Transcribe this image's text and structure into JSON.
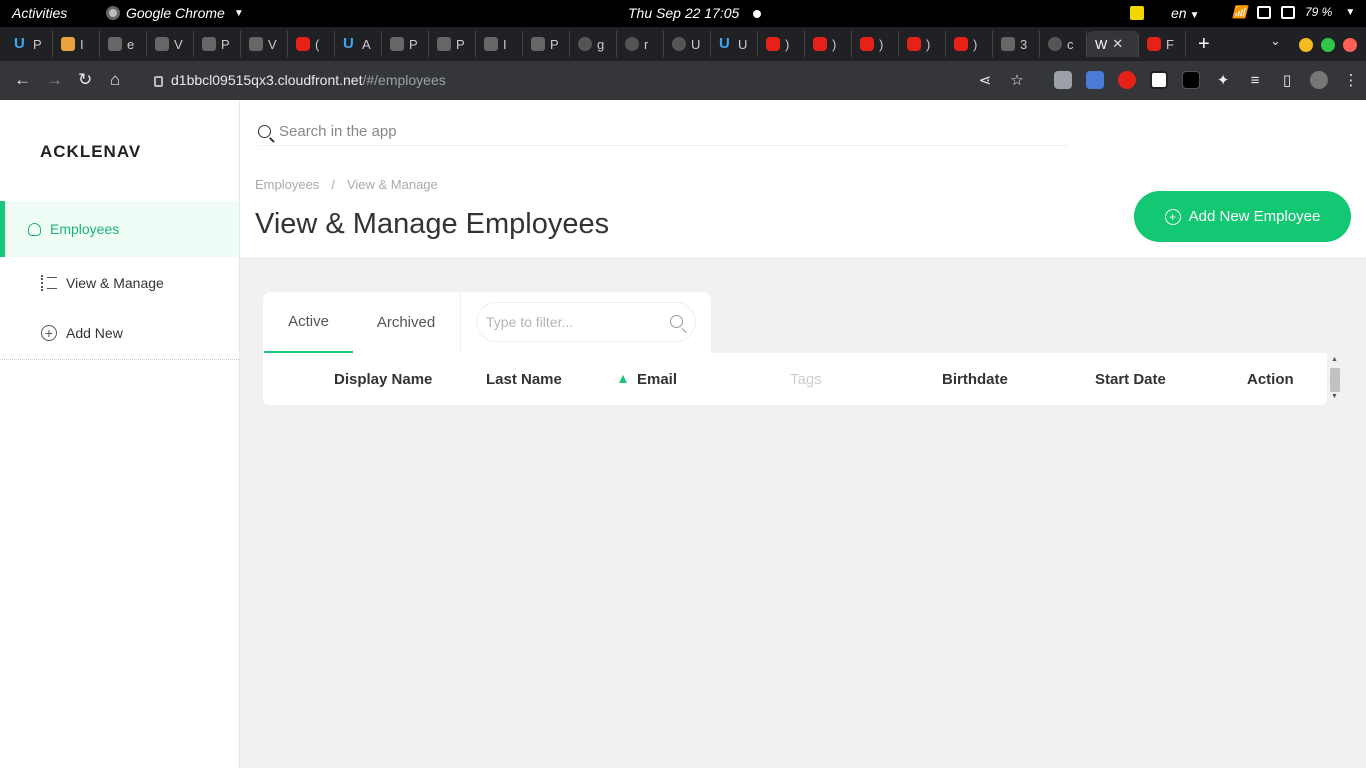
{
  "system": {
    "activities": "Activities",
    "app_name": "Google Chrome",
    "clock": "Thu Sep 22  17:05",
    "language": "en",
    "battery": "79 %"
  },
  "browser": {
    "tabs": [
      {
        "letter": "P",
        "icon": "upwork-icon"
      },
      {
        "letter": "I",
        "icon": "box-icon"
      },
      {
        "letter": "e",
        "icon": "globe-icon"
      },
      {
        "letter": "V",
        "icon": "globe-icon"
      },
      {
        "letter": "P",
        "icon": "page-icon"
      },
      {
        "letter": "V",
        "icon": "globe-icon"
      },
      {
        "letter": "(",
        "icon": "youtube-icon"
      },
      {
        "letter": "A",
        "icon": "upwork-icon"
      },
      {
        "letter": "P",
        "icon": "page-icon"
      },
      {
        "letter": "P",
        "icon": "page-icon"
      },
      {
        "letter": "I",
        "icon": "page-icon"
      },
      {
        "letter": "P",
        "icon": "target-icon"
      },
      {
        "letter": "g",
        "icon": "github-icon"
      },
      {
        "letter": "r",
        "icon": "github-icon"
      },
      {
        "letter": "U",
        "icon": "github-icon"
      },
      {
        "letter": "U",
        "icon": "upwork-icon"
      },
      {
        "letter": ")",
        "icon": "youtube-icon"
      },
      {
        "letter": ")",
        "icon": "youtube-icon"
      },
      {
        "letter": ")",
        "icon": "youtube-icon"
      },
      {
        "letter": ")",
        "icon": "youtube-icon"
      },
      {
        "letter": ")",
        "icon": "youtube-icon"
      },
      {
        "letter": "3",
        "icon": "globe-icon"
      },
      {
        "letter": "c",
        "icon": "github-icon"
      }
    ],
    "active_tab": {
      "letter": "W"
    },
    "next_tab": {
      "letter": "F"
    },
    "url_host": "d1bbcl09515qx3.cloudfront.net",
    "url_path": "/#/employees",
    "colors": {
      "close": "#f5b922",
      "minimize": "#f5b922",
      "maximize": "#30c648",
      "close_red": "#ff5f57"
    }
  },
  "app": {
    "logo": "ACKLENAVENUE",
    "search_placeholder": "Search in the app",
    "nav": {
      "employees": "Employees",
      "view_manage": "View & Manage",
      "add_new": "Add New"
    },
    "breadcrumb": [
      "Employees",
      "/",
      "View & Manage"
    ],
    "page_title": "View & Manage Employees",
    "add_button": "Add New Employee",
    "tabs": {
      "active": "Active",
      "archived": "Archived"
    },
    "filter_placeholder": "Type to filter...",
    "columns": [
      "Display Name",
      "Last Name",
      "Email",
      "Tags",
      "Birthdate",
      "Start Date",
      "Action"
    ],
    "accent": "#19c77a"
  }
}
